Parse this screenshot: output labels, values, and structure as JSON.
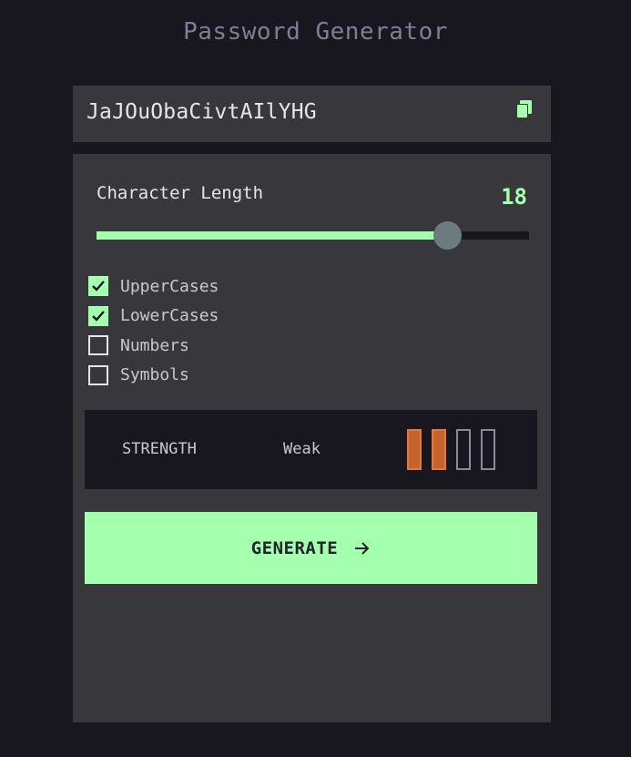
{
  "app": {
    "title": "Password Generator"
  },
  "password": {
    "value": "JaJOuObaCivtAIlYHG",
    "copy_icon": "copy-icon"
  },
  "length": {
    "label": "Character Length",
    "value": "18",
    "slider_fraction": 0.81
  },
  "options": [
    {
      "label": "UpperCases",
      "checked": true
    },
    {
      "label": "LowerCases",
      "checked": true
    },
    {
      "label": "Numbers",
      "checked": false
    },
    {
      "label": "Symbols",
      "checked": false
    }
  ],
  "strength": {
    "label": "STRENGTH",
    "value": "Weak",
    "level": 2,
    "max_level": 4,
    "color": "#c6622c"
  },
  "generate": {
    "label": "GENERATE",
    "icon": "arrow-right-icon"
  },
  "colors": {
    "accent": "#a4ffaf",
    "background": "#18171f",
    "panel": "#38383c"
  }
}
